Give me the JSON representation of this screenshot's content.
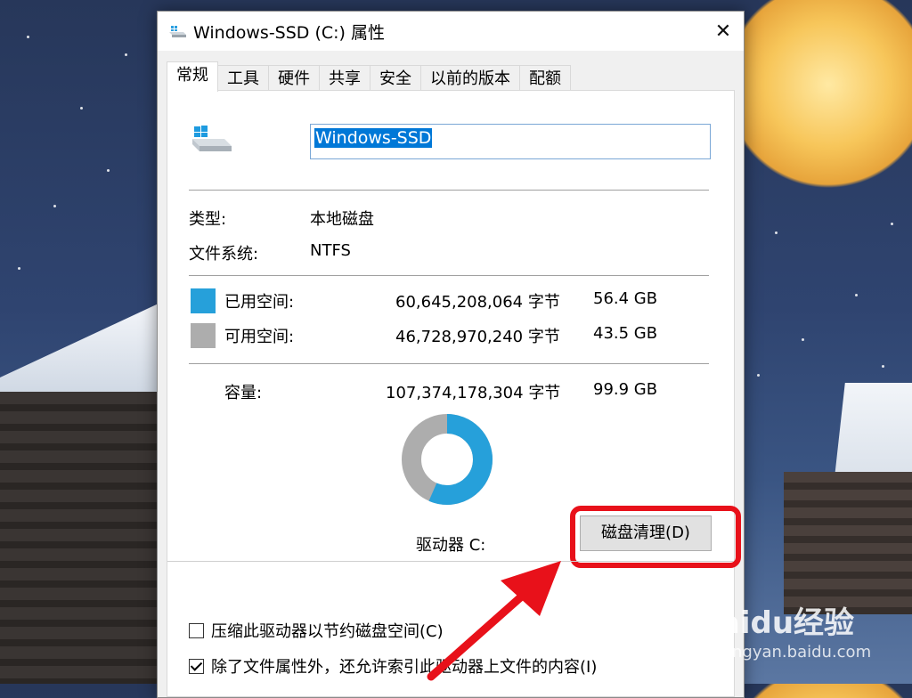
{
  "window": {
    "title": "Windows-SSD (C:) 属性",
    "close_glyph": "✕"
  },
  "tabs": [
    {
      "label": "常规",
      "active": true
    },
    {
      "label": "工具"
    },
    {
      "label": "硬件"
    },
    {
      "label": "共享"
    },
    {
      "label": "安全"
    },
    {
      "label": "以前的版本"
    },
    {
      "label": "配额"
    }
  ],
  "drive": {
    "name_value": "Windows-SSD"
  },
  "info": {
    "type_label": "类型:",
    "type_value": "本地磁盘",
    "fs_label": "文件系统:",
    "fs_value": "NTFS"
  },
  "space": {
    "used_label": "已用空间:",
    "used_bytes": "60,645,208,064 字节",
    "used_gb": "56.4 GB",
    "used_color": "#26a0da",
    "free_label": "可用空间:",
    "free_bytes": "46,728,970,240 字节",
    "free_gb": "43.5 GB",
    "free_color": "#adadad",
    "capacity_label": "容量:",
    "capacity_bytes": "107,374,178,304 字节",
    "capacity_gb": "99.9 GB",
    "used_fraction": 0.565
  },
  "drive_label": "驱动器 C:",
  "cleanup_button": "磁盘清理(D)",
  "options": {
    "compress_label": "压缩此驱动器以节约磁盘空间(C)",
    "compress_checked": false,
    "index_label": "除了文件属性外，还允许索引此驱动器上文件的内容(I)",
    "index_checked": true
  },
  "watermark": {
    "logo": "Baidu经验",
    "site": "jingyan.baidu.com"
  },
  "icons": [
    "drive-icon",
    "close-icon",
    "checkbox-icon",
    "arrow-annotation"
  ],
  "colors": {
    "highlight": "#e8111a",
    "selection": "#0078d7"
  }
}
